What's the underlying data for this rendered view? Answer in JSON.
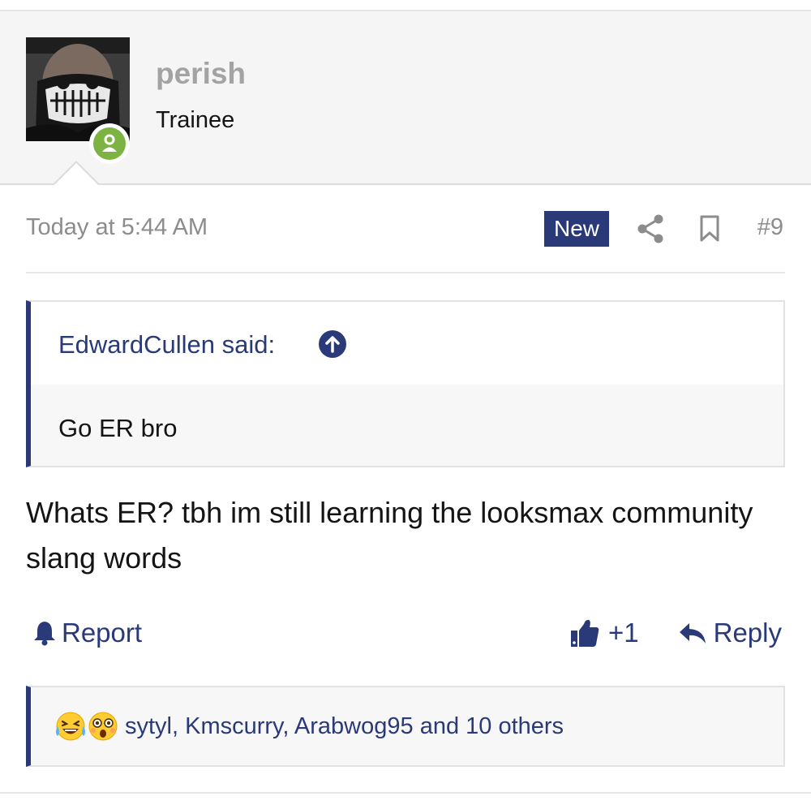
{
  "user": {
    "name": "perish",
    "title": "Trainee",
    "avatar_icon": "masked-face-avatar",
    "online_icon": "user-online-icon"
  },
  "post_meta": {
    "date": "Today at 5:44 AM",
    "new_label": "New",
    "post_number": "#9",
    "share_icon": "share-icon",
    "bookmark_icon": "bookmark-icon"
  },
  "quote": {
    "author_said": "EdwardCullen said:",
    "text": "Go ER bro"
  },
  "message": {
    "text": "Whats ER? tbh im still learning the looksmax community slang words"
  },
  "actions": {
    "report_label": "Report",
    "like_count": "+1",
    "reply_label": "Reply"
  },
  "reactions": {
    "emojis": [
      "laughing-crying-emoji",
      "flushed-emoji"
    ],
    "users_text": "sytyl, Kmscurry, Arabwog95 and 10 others"
  },
  "colors": {
    "accent": "#2a3a78",
    "online": "#7cb342",
    "muted_text": "#8c8c8c",
    "header_bg": "#f5f5f5"
  }
}
